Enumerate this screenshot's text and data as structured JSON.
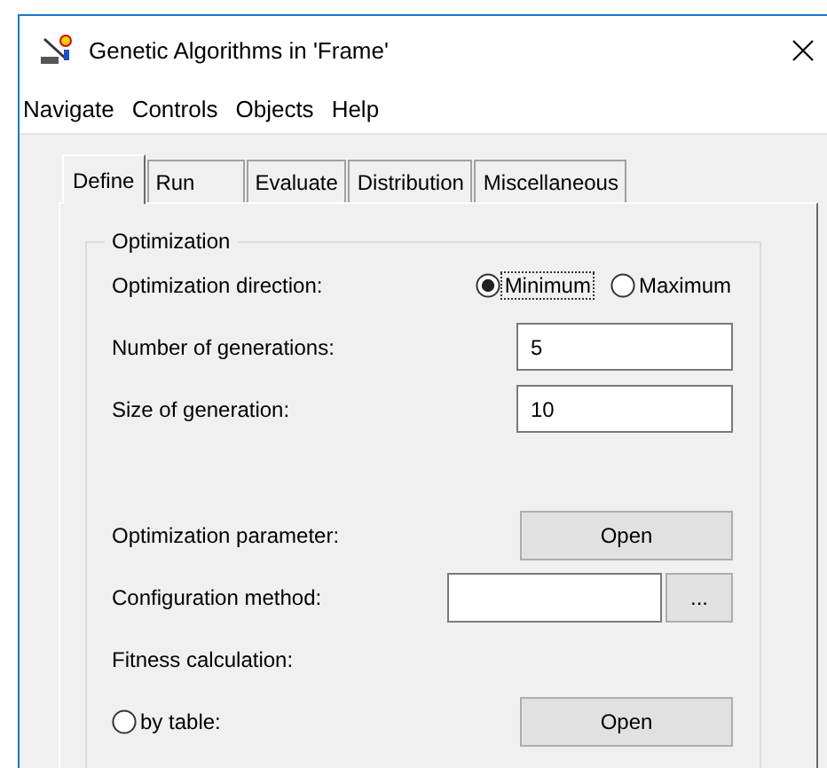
{
  "window": {
    "title": "Genetic Algorithms in 'Frame'"
  },
  "menu": [
    "Navigate",
    "Controls",
    "Objects",
    "Help"
  ],
  "tabs": [
    {
      "label": "Define",
      "selected": true
    },
    {
      "label": "Run",
      "selected": false
    },
    {
      "label": "Evaluate",
      "selected": false
    },
    {
      "label": "Distribution",
      "selected": false
    },
    {
      "label": "Miscellaneous",
      "selected": false
    }
  ],
  "group": {
    "legend": "Optimization",
    "settings": [
      {
        "kind": "radio",
        "label": "Optimization direction:",
        "options": [
          {
            "label": "Minimum",
            "selected": true,
            "focused": true
          },
          {
            "label": "Maximum",
            "selected": false,
            "focused": false
          }
        ]
      },
      {
        "kind": "input",
        "label": "Number of generations:",
        "value": "5"
      },
      {
        "kind": "input",
        "label": "Size of generation:",
        "value": "10"
      }
    ],
    "parameters": [
      {
        "kind": "button",
        "label": "Optimization parameter:",
        "button": "Open"
      },
      {
        "kind": "browse",
        "label": "Configuration method:",
        "button": "..."
      },
      {
        "kind": "heading",
        "label": "Fitness calculation:"
      },
      {
        "kind": "radio_button",
        "label": "by table:",
        "selected": false,
        "button": "Open"
      }
    ]
  }
}
